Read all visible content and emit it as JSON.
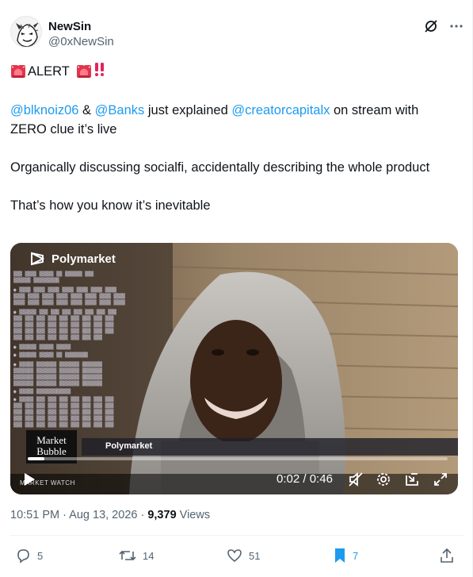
{
  "author": {
    "display_name": "NewSin",
    "handle": "@0xNewSin"
  },
  "header_icons": [
    "grok-icon",
    "more-icon"
  ],
  "tweet": {
    "alert_text": "ALERT",
    "alert_emojis": [
      "police-light-icon",
      "police-light-icon",
      "double-exclamation-icon"
    ],
    "line1_mention1": "@blknoiz06",
    "line1_amp": " & ",
    "line1_mention2": "@Banks",
    "line1_mid": " just explained ",
    "line1_mention3": "@creatorcapitalx",
    "line1_end": " on stream with ZERO clue it’s live",
    "paragraph2": "Organically discussing socialfi, accidentally describing the whole product",
    "paragraph3": "That’s how you know it’s inevitable"
  },
  "video": {
    "overlay_brand": "Polymarket",
    "overlay_show": "Market Bubble",
    "ticker_brand": "Polymarket",
    "ticker_left": "MARKET WATCH",
    "time_current": "0:02",
    "time_separator": " / ",
    "time_total": "0:46",
    "progress_fraction": 0.04
  },
  "meta": {
    "time": "10:51 PM",
    "separator1": " · ",
    "date": "Aug 13, 2026",
    "separator2": " · ",
    "views_count": "9,379",
    "views_label": " Views"
  },
  "actions": {
    "replies": "5",
    "reposts": "14",
    "likes": "51",
    "bookmarks": "7"
  },
  "colors": {
    "link": "#1d9bf0",
    "text": "#0f1419",
    "muted": "#536471",
    "bookmark_active": "#1d9bf0"
  }
}
